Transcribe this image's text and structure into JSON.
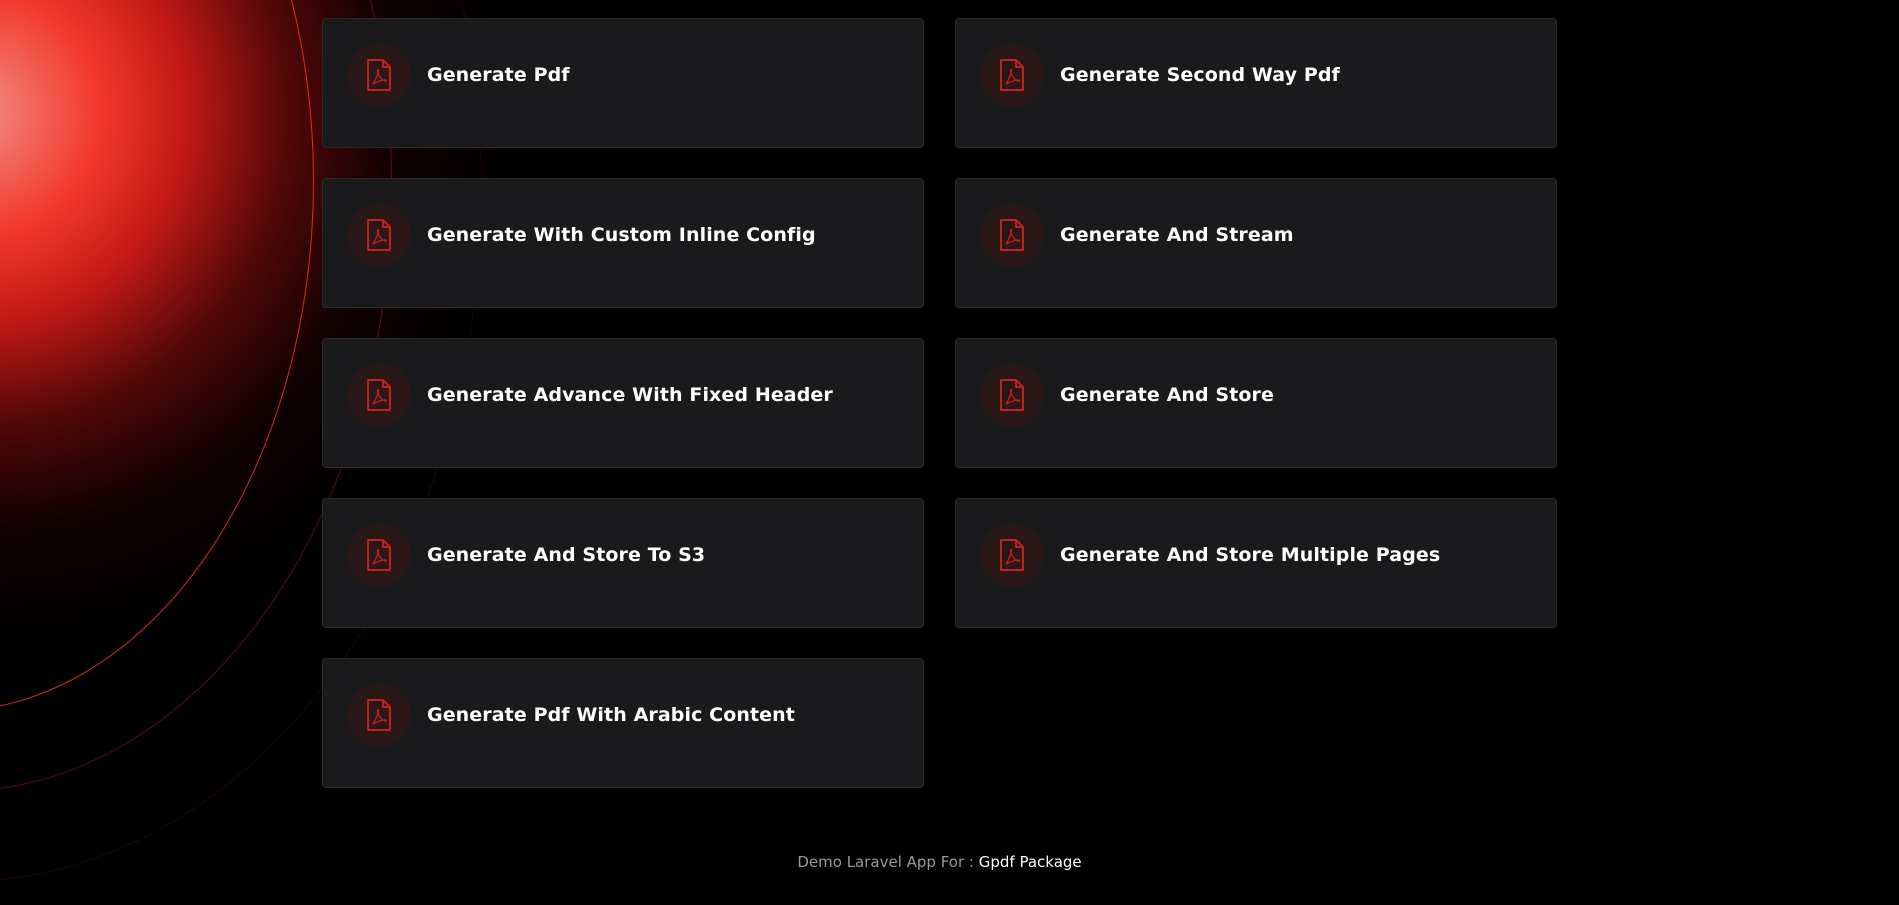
{
  "colors": {
    "background": "#000000",
    "card_bg": "#1a1a1c",
    "card_border": "#2a2a2d",
    "icon_bg": "#2a1818",
    "icon_accent": "#c0211b",
    "accent_glow": "#ff3b2d"
  },
  "cards": [
    {
      "label": "Generate Pdf",
      "icon": "pdf-file-icon"
    },
    {
      "label": "Generate Second Way Pdf",
      "icon": "pdf-file-icon"
    },
    {
      "label": "Generate With Custom Inline Config",
      "icon": "pdf-file-icon"
    },
    {
      "label": "Generate And Stream",
      "icon": "pdf-file-icon"
    },
    {
      "label": "Generate Advance With Fixed Header",
      "icon": "pdf-file-icon"
    },
    {
      "label": "Generate And Store",
      "icon": "pdf-file-icon"
    },
    {
      "label": "Generate And Store To S3",
      "icon": "pdf-file-icon"
    },
    {
      "label": "Generate And Store Multiple Pages",
      "icon": "pdf-file-icon"
    },
    {
      "label": "Generate Pdf With Arabic Content",
      "icon": "pdf-file-icon"
    }
  ],
  "footer": {
    "prefix": "Demo Laravel App For : ",
    "link_text": "Gpdf Package"
  }
}
